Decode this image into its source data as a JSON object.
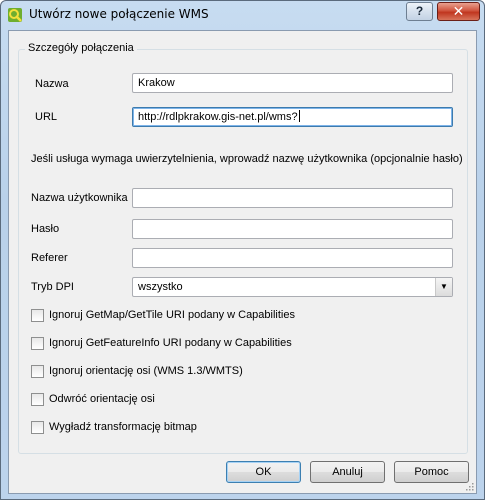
{
  "window": {
    "title": "Utwórz nowe połączenie WMS",
    "help_label": "?",
    "close_label": "✕"
  },
  "group": {
    "title": "Szczegóły połączenia"
  },
  "fields": {
    "name_label": "Nazwa",
    "name_value": "Krakow",
    "url_label": "URL",
    "url_value": "http://rdlpkrakow.gis-net.pl/wms?",
    "auth_note": "Jeśli usługa wymaga uwierzytelnienia, wprowadź nazwę użytkownika (opcjonalnie hasło)",
    "user_label": "Nazwa użytkownika",
    "user_value": "",
    "password_label": "Hasło",
    "password_value": "",
    "referer_label": "Referer",
    "referer_value": "",
    "dpi_label": "Tryb DPI",
    "dpi_value": "wszystko"
  },
  "checkboxes": [
    {
      "label": "Ignoruj GetMap/GetTile URI podany w Capabilities",
      "checked": false
    },
    {
      "label": "Ignoruj GetFeatureInfo URI podany w Capabilities",
      "checked": false
    },
    {
      "label": "Ignoruj orientację osi (WMS 1.3/WMTS)",
      "checked": false
    },
    {
      "label": "Odwróć orientację osi",
      "checked": false
    },
    {
      "label": "Wygładź transformację bitmap",
      "checked": false
    }
  ],
  "buttons": {
    "ok": "OK",
    "cancel": "Anuluj",
    "help": "Pomoc"
  }
}
